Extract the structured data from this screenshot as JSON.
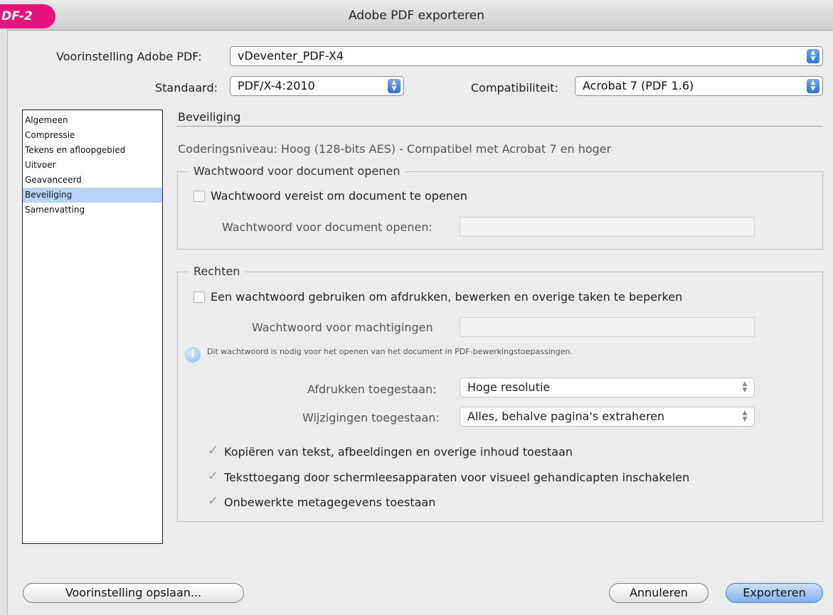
{
  "window": {
    "title": "Adobe PDF exporteren",
    "tab_label": "DF-2"
  },
  "preset": {
    "label": "Voorinstelling Adobe PDF:",
    "value": "vDeventer_PDF-X4"
  },
  "standard": {
    "label": "Standaard:",
    "value": "PDF/X-4:2010"
  },
  "compatibility": {
    "label": "Compatibiliteit:",
    "value": "Acrobat 7 (PDF 1.6)"
  },
  "sidebar": {
    "items": [
      {
        "label": "Algemeen"
      },
      {
        "label": "Compressie"
      },
      {
        "label": "Tekens en afloopgebied"
      },
      {
        "label": "Uitvoer"
      },
      {
        "label": "Geavanceerd"
      },
      {
        "label": "Beveiliging"
      },
      {
        "label": "Samenvatting"
      }
    ]
  },
  "panel": {
    "heading": "Beveiliging",
    "encryption_level": "Coderingsniveau: Hoog (128-bits AES) - Compatibel met Acrobat 7 en hoger",
    "open_group": {
      "legend": "Wachtwoord voor document openen",
      "require_checkbox": "Wachtwoord vereist om document te openen",
      "password_label": "Wachtwoord voor document openen:"
    },
    "rights_group": {
      "legend": "Rechten",
      "use_password_checkbox": "Een wachtwoord gebruiken om afdrukken, bewerken en overige taken te beperken",
      "permissions_label": "Wachtwoord voor machtigingen",
      "info_text": "Dit wachtwoord is nodig voor het openen van het document in PDF-bewerkingstoepassingen.",
      "print_label": "Afdrukken toegestaan:",
      "print_value": "Hoge resolutie",
      "changes_label": "Wijzigingen toegestaan:",
      "changes_value": "Alles, behalve pagina's extraheren",
      "copy_checkbox": "Kopiëren van tekst, afbeeldingen en overige inhoud toestaan",
      "screenreader_checkbox": "Teksttoegang door schermleesapparaten voor visueel gehandicapten inschakelen",
      "metadata_checkbox": "Onbewerkte metagegevens toestaan"
    }
  },
  "buttons": {
    "save_preset": "Voorinstelling opslaan...",
    "cancel": "Annuleren",
    "export": "Exporteren"
  }
}
